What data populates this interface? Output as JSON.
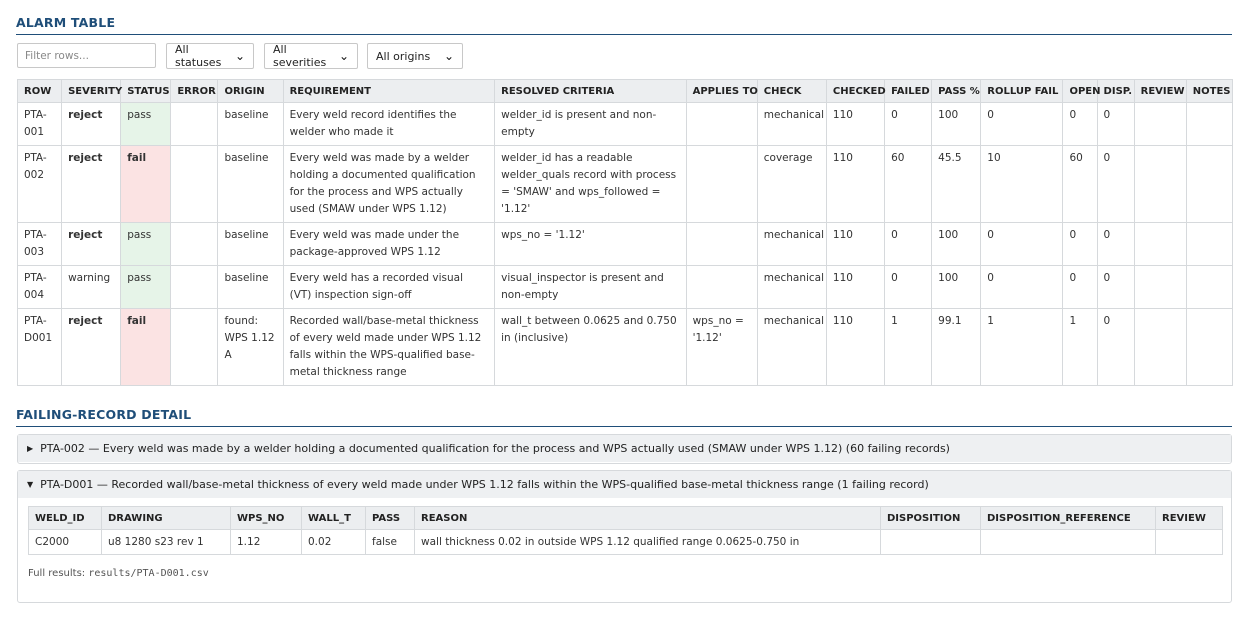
{
  "alarm_section": {
    "title": "ALARM TABLE"
  },
  "filters": {
    "placeholder": "Filter rows...",
    "status": "All statuses",
    "severity": "All severities",
    "origin": "All origins"
  },
  "columns": [
    "ROW",
    "SEVERITY",
    "STATUS",
    "ERROR",
    "ORIGIN",
    "REQUIREMENT",
    "RESOLVED CRITERIA",
    "APPLIES TO",
    "CHECK",
    "CHECKED",
    "FAILED",
    "PASS %",
    "ROLLUP FAIL",
    "OPEN",
    "DISP.",
    "REVIEW",
    "NOTES"
  ],
  "rows": [
    {
      "row": "PTA-001",
      "severity": "reject",
      "status": "pass",
      "error": "",
      "origin": "baseline",
      "requirement": "Every weld record identifies the welder who made it",
      "criteria": "welder_id is present and non-empty",
      "applies_to": "",
      "check": "mechanical",
      "checked": "110",
      "failed": "0",
      "pass_pct": "100",
      "rollup_fail": "0",
      "open": "0",
      "disp": "0",
      "review": "",
      "notes": ""
    },
    {
      "row": "PTA-002",
      "severity": "reject",
      "status": "fail",
      "error": "",
      "origin": "baseline",
      "requirement": "Every weld was made by a welder holding a documented qualification for the process and WPS actually used (SMAW under WPS 1.12)",
      "criteria": "welder_id has a readable welder_quals record with process = 'SMAW' and wps_followed = '1.12'",
      "applies_to": "",
      "check": "coverage",
      "checked": "110",
      "failed": "60",
      "pass_pct": "45.5",
      "rollup_fail": "10",
      "open": "60",
      "disp": "0",
      "review": "",
      "notes": ""
    },
    {
      "row": "PTA-003",
      "severity": "reject",
      "status": "pass",
      "error": "",
      "origin": "baseline",
      "requirement": "Every weld was made under the package-approved WPS 1.12",
      "criteria": "wps_no = '1.12'",
      "applies_to": "",
      "check": "mechanical",
      "checked": "110",
      "failed": "0",
      "pass_pct": "100",
      "rollup_fail": "0",
      "open": "0",
      "disp": "0",
      "review": "",
      "notes": ""
    },
    {
      "row": "PTA-004",
      "severity": "warning",
      "status": "pass",
      "error": "",
      "origin": "baseline",
      "requirement": "Every weld has a recorded visual (VT) inspection sign-off",
      "criteria": "visual_inspector is present and non-empty",
      "applies_to": "",
      "check": "mechanical",
      "checked": "110",
      "failed": "0",
      "pass_pct": "100",
      "rollup_fail": "0",
      "open": "0",
      "disp": "0",
      "review": "",
      "notes": ""
    },
    {
      "row": "PTA-D001",
      "severity": "reject",
      "status": "fail",
      "error": "",
      "origin": "found: WPS 1.12 A",
      "requirement": "Recorded wall/base-metal thickness of every weld made under WPS 1.12 falls within the WPS-qualified base-metal thickness range",
      "criteria": "wall_t between 0.0625 and 0.750 in (inclusive)",
      "applies_to": "wps_no = '1.12'",
      "check": "mechanical",
      "checked": "110",
      "failed": "1",
      "pass_pct": "99.1",
      "rollup_fail": "1",
      "open": "1",
      "disp": "0",
      "review": "",
      "notes": ""
    }
  ],
  "detail_section": {
    "title": "FAILING-RECORD DETAIL"
  },
  "details": [
    {
      "expanded": false,
      "toggle": "▶",
      "heading": "PTA-002 — Every weld was made by a welder holding a documented qualification for the process and WPS actually used (SMAW under WPS 1.12) (60 failing records)"
    },
    {
      "expanded": true,
      "toggle": "▼",
      "heading": "PTA-D001 — Recorded wall/base-metal thickness of every weld made under WPS 1.12 falls within the WPS-qualified base-metal thickness range (1 failing record)",
      "columns": [
        "WELD_ID",
        "DRAWING",
        "WPS_NO",
        "WALL_T",
        "PASS",
        "REASON",
        "DISPOSITION",
        "DISPOSITION_REFERENCE",
        "REVIEW"
      ],
      "records": [
        {
          "weld_id": "C2000",
          "drawing": "u8 1280 s23 rev 1",
          "wps_no": "1.12",
          "wall_t": "0.02",
          "pass": "false",
          "reason": "wall thickness 0.02 in outside WPS 1.12 qualified range 0.0625-0.750 in",
          "disposition": "",
          "disposition_reference": "",
          "review": ""
        }
      ],
      "full_results_label": "Full results:",
      "full_results_path": "results/PTA-D001.csv"
    }
  ],
  "icons": {
    "select_chevron": "chevron-down-icon"
  }
}
